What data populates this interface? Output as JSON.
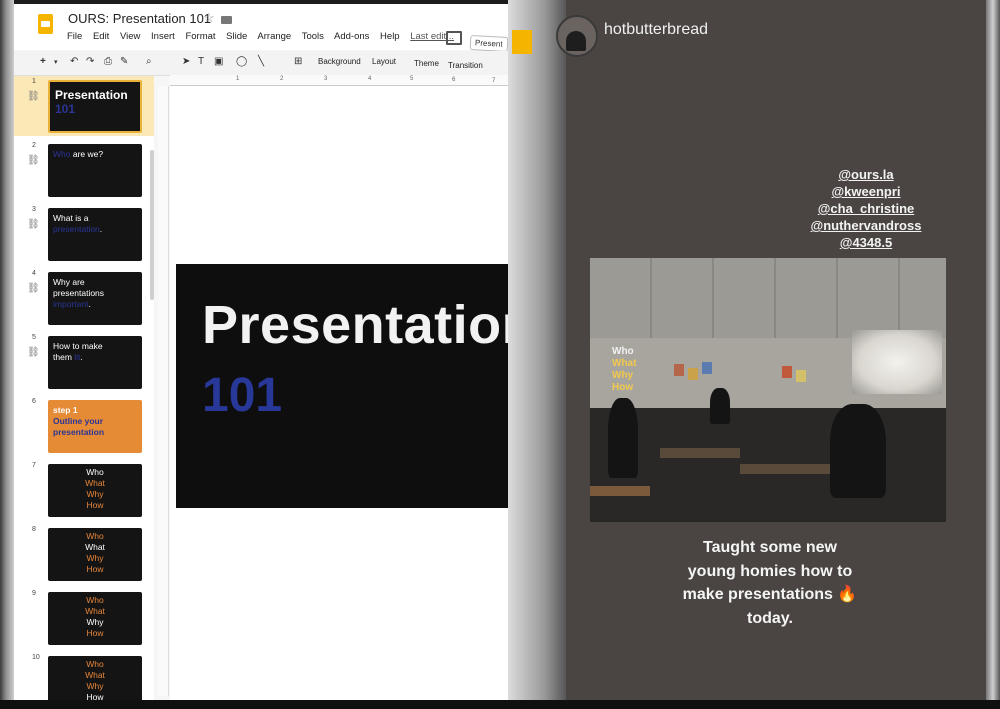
{
  "app": {
    "doc_title": "OURS: Presentation 101",
    "star_glyph": "☆",
    "menu": [
      "File",
      "Edit",
      "View",
      "Insert",
      "Format",
      "Slide",
      "Arrange",
      "Tools",
      "Add-ons",
      "Help"
    ],
    "last_edit": "Last edit...",
    "present_label": "Present",
    "toolbar": {
      "new_slide": "+",
      "background": "Background",
      "layout": "Layout",
      "theme": "Theme",
      "transition": "Transition"
    },
    "ruler_ticks": [
      "1",
      "2",
      "3",
      "4",
      "5",
      "6",
      "7"
    ]
  },
  "slides": [
    {
      "num": "1",
      "lines": [
        {
          "text": "Presentation",
          "color": "white"
        },
        {
          "text": "101",
          "color": "blue"
        }
      ]
    },
    {
      "num": "2",
      "lines": [
        {
          "text": "Who",
          "color": "blue"
        },
        {
          "text": " are we?",
          "color": "white"
        }
      ]
    },
    {
      "num": "3",
      "lines": [
        {
          "text": "What is a",
          "color": "white"
        },
        {
          "text": "presentation",
          "color": "blue"
        },
        {
          "text": ".",
          "color": "white"
        }
      ]
    },
    {
      "num": "4",
      "lines": [
        {
          "text": "Why are",
          "color": "white"
        },
        {
          "text": "presentations",
          "color": "white"
        },
        {
          "text": "important",
          "color": "blue"
        },
        {
          "text": ".",
          "color": "white"
        }
      ]
    },
    {
      "num": "5",
      "lines": [
        {
          "text": "How to make",
          "color": "white"
        },
        {
          "text": "them ",
          "color": "white"
        },
        {
          "text": "lit",
          "color": "blue"
        },
        {
          "text": ".",
          "color": "white"
        }
      ]
    },
    {
      "num": "6",
      "lines": [
        {
          "text": "step 1",
          "color": "white"
        },
        {
          "text": "Outline your",
          "color": "blue"
        },
        {
          "text": "presentation",
          "color": "blue"
        }
      ]
    },
    {
      "num": "7",
      "lines": [
        {
          "text": "Who",
          "color": "white"
        },
        {
          "text": "What",
          "color": "orange"
        },
        {
          "text": "Why",
          "color": "orange"
        },
        {
          "text": "How",
          "color": "orange"
        }
      ]
    },
    {
      "num": "8",
      "lines": [
        {
          "text": "Who",
          "color": "orange"
        },
        {
          "text": "What",
          "color": "white"
        },
        {
          "text": "Why",
          "color": "orange"
        },
        {
          "text": "How",
          "color": "orange"
        }
      ]
    },
    {
      "num": "9",
      "lines": [
        {
          "text": "Who",
          "color": "orange"
        },
        {
          "text": "What",
          "color": "orange"
        },
        {
          "text": "Why",
          "color": "white"
        },
        {
          "text": "How",
          "color": "orange"
        }
      ]
    },
    {
      "num": "10",
      "lines": [
        {
          "text": "Who",
          "color": "orange"
        },
        {
          "text": "What",
          "color": "orange"
        },
        {
          "text": "Why",
          "color": "orange"
        },
        {
          "text": "How",
          "color": "white"
        }
      ]
    }
  ],
  "main_slide": {
    "title": "Presentation",
    "subtitle": "101"
  },
  "story": {
    "username": "hotbutterbread",
    "mentions": [
      "@ours.la",
      "@kweenpri",
      "@cha_christine",
      "@nuthervandross",
      "@4348.5"
    ],
    "photo_overlay": [
      "Who",
      "What",
      "Why",
      "How"
    ],
    "caption_lines": [
      "Taught some new",
      "young homies how to",
      "make presentations 🔥",
      "today."
    ]
  },
  "colors": {
    "accent_yellow": "#f4b400",
    "slide_blue": "#283899",
    "slide_orange": "#e58a35"
  }
}
